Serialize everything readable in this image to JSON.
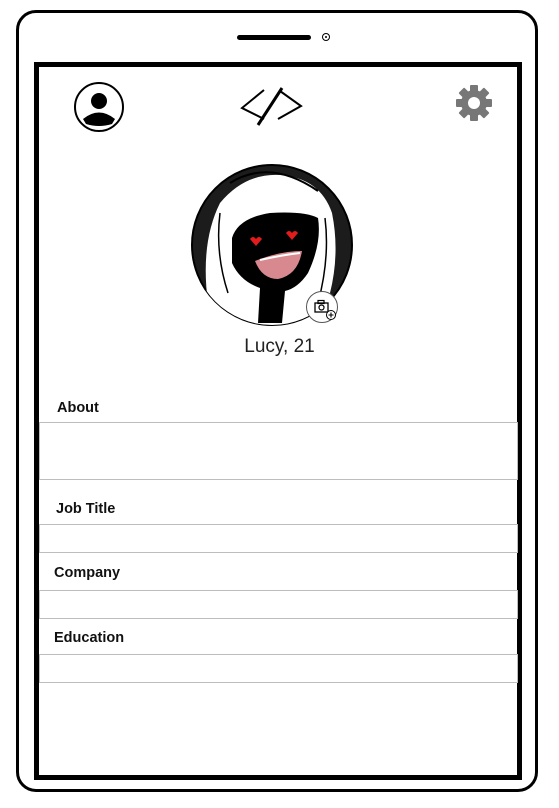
{
  "header": {
    "profile_icon": "person-icon",
    "logo_icon": "code-logo-icon",
    "settings_icon": "gear-icon"
  },
  "profile": {
    "name_age": "Lucy, 21",
    "photo_action_icon": "add-photo-icon"
  },
  "fields": [
    {
      "label": "About",
      "value": ""
    },
    {
      "label": "Job Title",
      "value": ""
    },
    {
      "label": "Company",
      "value": ""
    },
    {
      "label": "Education",
      "value": ""
    }
  ],
  "colors": {
    "frame": "#000000",
    "divider": "#bdbdbd",
    "gear": "#777777",
    "eyes": "#e21b1b",
    "mouth": "#d8898f"
  }
}
